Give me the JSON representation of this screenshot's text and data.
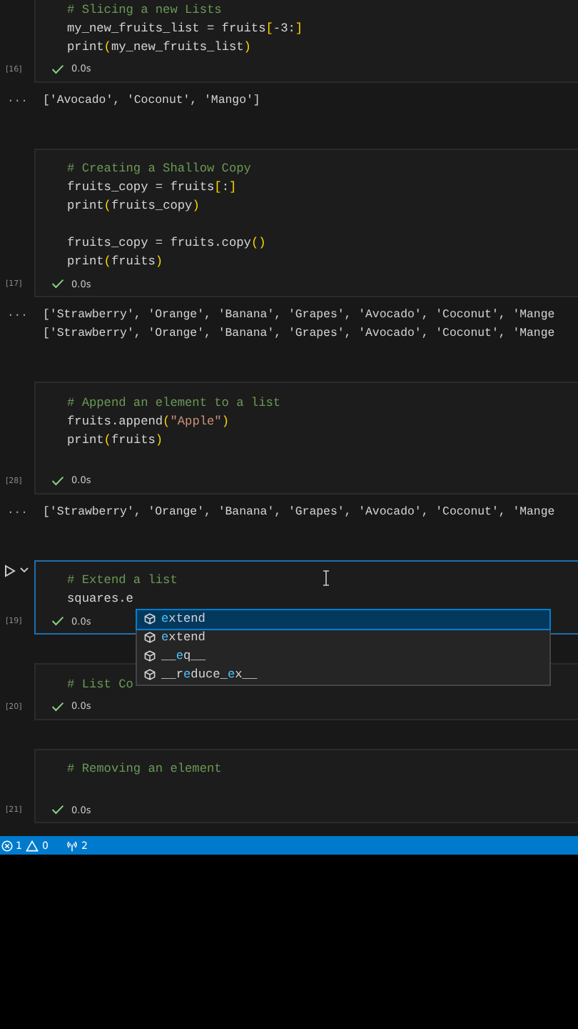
{
  "cells": [
    {
      "exec_count": "[16]",
      "focused": false,
      "duration": "0.0s",
      "lines": [
        {
          "kind": "code",
          "segments": [
            {
              "t": "# Slicing a new Lists",
              "kind": "comment"
            }
          ]
        },
        {
          "kind": "code",
          "segments": [
            {
              "t": "my_new_fruits_list = fruits",
              "kind": "plain"
            },
            {
              "t": "[",
              "kind": "bracket"
            },
            {
              "t": "-3:",
              "kind": "plain"
            },
            {
              "t": "]",
              "kind": "bracket"
            }
          ]
        },
        {
          "kind": "code",
          "segments": [
            {
              "t": "print",
              "kind": "plain"
            },
            {
              "t": "(",
              "kind": "bracket"
            },
            {
              "t": "my_new_fruits_list",
              "kind": "plain"
            },
            {
              "t": ")",
              "kind": "bracket"
            }
          ]
        }
      ],
      "output_marker": "...",
      "output": [
        "['Avocado', 'Coconut', 'Mango']"
      ]
    },
    {
      "exec_count": "[17]",
      "focused": false,
      "duration": "0.0s",
      "lines": [
        {
          "kind": "code",
          "segments": [
            {
              "t": "# Creating a Shallow Copy",
              "kind": "comment"
            }
          ]
        },
        {
          "kind": "code",
          "segments": [
            {
              "t": "fruits_copy = fruits",
              "kind": "plain"
            },
            {
              "t": "[",
              "kind": "bracket"
            },
            {
              "t": ":",
              "kind": "plain"
            },
            {
              "t": "]",
              "kind": "bracket"
            }
          ]
        },
        {
          "kind": "code",
          "segments": [
            {
              "t": "print",
              "kind": "plain"
            },
            {
              "t": "(",
              "kind": "bracket"
            },
            {
              "t": "fruits_copy",
              "kind": "plain"
            },
            {
              "t": ")",
              "kind": "bracket"
            }
          ]
        },
        {
          "kind": "blank"
        },
        {
          "kind": "code",
          "segments": [
            {
              "t": "fruits_copy = fruits.copy",
              "kind": "plain"
            },
            {
              "t": "()",
              "kind": "bracket"
            }
          ]
        },
        {
          "kind": "code",
          "segments": [
            {
              "t": "print",
              "kind": "plain"
            },
            {
              "t": "(",
              "kind": "bracket"
            },
            {
              "t": "fruits",
              "kind": "plain"
            },
            {
              "t": ")",
              "kind": "bracket"
            }
          ]
        }
      ],
      "output_marker": "...",
      "output": [
        "['Strawberry', 'Orange', 'Banana', 'Grapes', 'Avocado', 'Coconut', 'Mange",
        "['Strawberry', 'Orange', 'Banana', 'Grapes', 'Avocado', 'Coconut', 'Mange"
      ]
    },
    {
      "exec_count": "[28]",
      "focused": false,
      "duration": "0.0s",
      "lines": [
        {
          "kind": "code",
          "segments": [
            {
              "t": "# Append an element to a list",
              "kind": "comment"
            }
          ]
        },
        {
          "kind": "code",
          "segments": [
            {
              "t": "fruits.append",
              "kind": "plain"
            },
            {
              "t": "(",
              "kind": "bracket"
            },
            {
              "t": "\"Apple\"",
              "kind": "string"
            },
            {
              "t": ")",
              "kind": "bracket"
            }
          ]
        },
        {
          "kind": "code",
          "segments": [
            {
              "t": "print",
              "kind": "plain"
            },
            {
              "t": "(",
              "kind": "bracket"
            },
            {
              "t": "fruits",
              "kind": "plain"
            },
            {
              "t": ")",
              "kind": "bracket"
            }
          ]
        },
        {
          "kind": "blank"
        }
      ],
      "output_marker": "...",
      "output": [
        "['Strawberry', 'Orange', 'Banana', 'Grapes', 'Avocado', 'Coconut', 'Mange"
      ]
    },
    {
      "exec_count": "[19]",
      "focused": true,
      "duration": "0.0s",
      "lines": [
        {
          "kind": "code",
          "segments": [
            {
              "t": "# Extend a list",
              "kind": "comment"
            }
          ]
        },
        {
          "kind": "code",
          "segments": [
            {
              "t": "squares.e",
              "kind": "plain"
            }
          ]
        }
      ],
      "suggestions": [
        {
          "selected": true,
          "parts": [
            {
              "t": "e",
              "match": true
            },
            {
              "t": "xtend",
              "match": false
            }
          ]
        },
        {
          "selected": false,
          "parts": [
            {
              "t": "e",
              "match": true
            },
            {
              "t": "xtend",
              "match": false
            }
          ]
        },
        {
          "selected": false,
          "parts": [
            {
              "t": "__",
              "match": false
            },
            {
              "t": "e",
              "match": true
            },
            {
              "t": "q__",
              "match": false
            }
          ]
        },
        {
          "selected": false,
          "parts": [
            {
              "t": "__r",
              "match": false
            },
            {
              "t": "e",
              "match": true
            },
            {
              "t": "duce_",
              "match": false
            },
            {
              "t": "e",
              "match": true
            },
            {
              "t": "x__",
              "match": false
            }
          ]
        }
      ]
    },
    {
      "exec_count": "[20]",
      "focused": false,
      "duration": "0.0s",
      "lines": [
        {
          "kind": "code",
          "segments": [
            {
              "t": "# List Co",
              "kind": "comment"
            }
          ]
        }
      ]
    },
    {
      "exec_count": "[21]",
      "focused": false,
      "duration": "0.0s",
      "lines": [
        {
          "kind": "code",
          "segments": [
            {
              "t": "# Removing an element",
              "kind": "comment"
            }
          ]
        },
        {
          "kind": "blank"
        }
      ]
    }
  ],
  "status_bar": {
    "errors": "1",
    "warnings": "0",
    "ports": "2"
  }
}
